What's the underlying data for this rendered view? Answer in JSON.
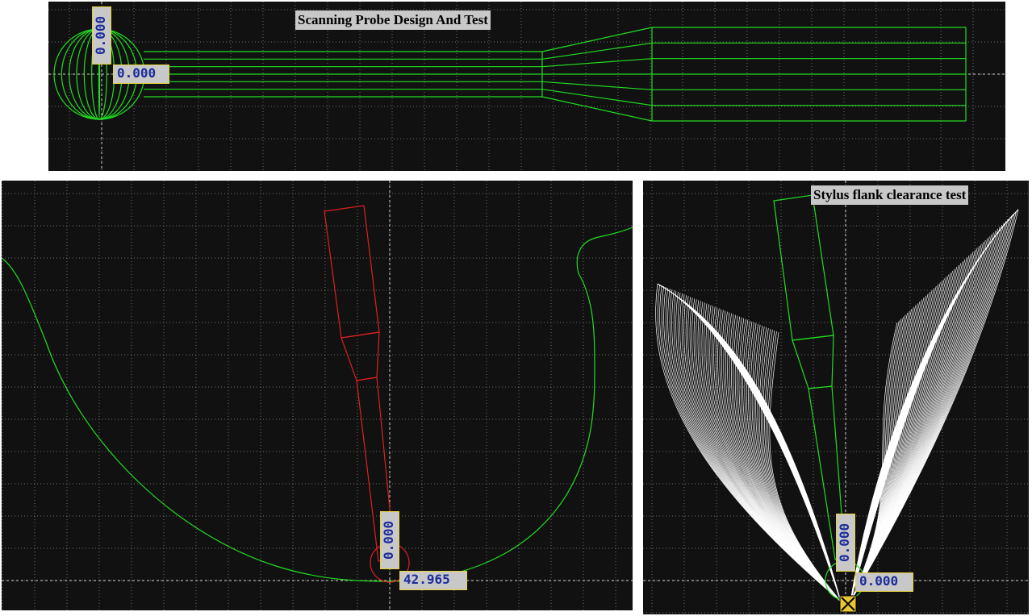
{
  "colors": {
    "background": "#111111",
    "grid": "#6e6e6e",
    "axis": "#d8d8d8",
    "profile": "#22dd22",
    "stylus_red": "#dd2020",
    "envelope": "#ffffff",
    "label_bg": "#c8c8c8",
    "label_border": "#e6d23c",
    "dim_text": "#1c2c9c"
  },
  "top_view": {
    "title": "Scanning Probe Design And Test",
    "dim_vertical": "0.000",
    "dim_horizontal": "0.000"
  },
  "left_view": {
    "dim_vertical": "0.000",
    "dim_horizontal": "42.965"
  },
  "right_view": {
    "title": "Stylus flank clearance test",
    "dim_vertical": "0.000",
    "dim_horizontal": "0.000",
    "marker_icon": "origin-marker-icon"
  }
}
